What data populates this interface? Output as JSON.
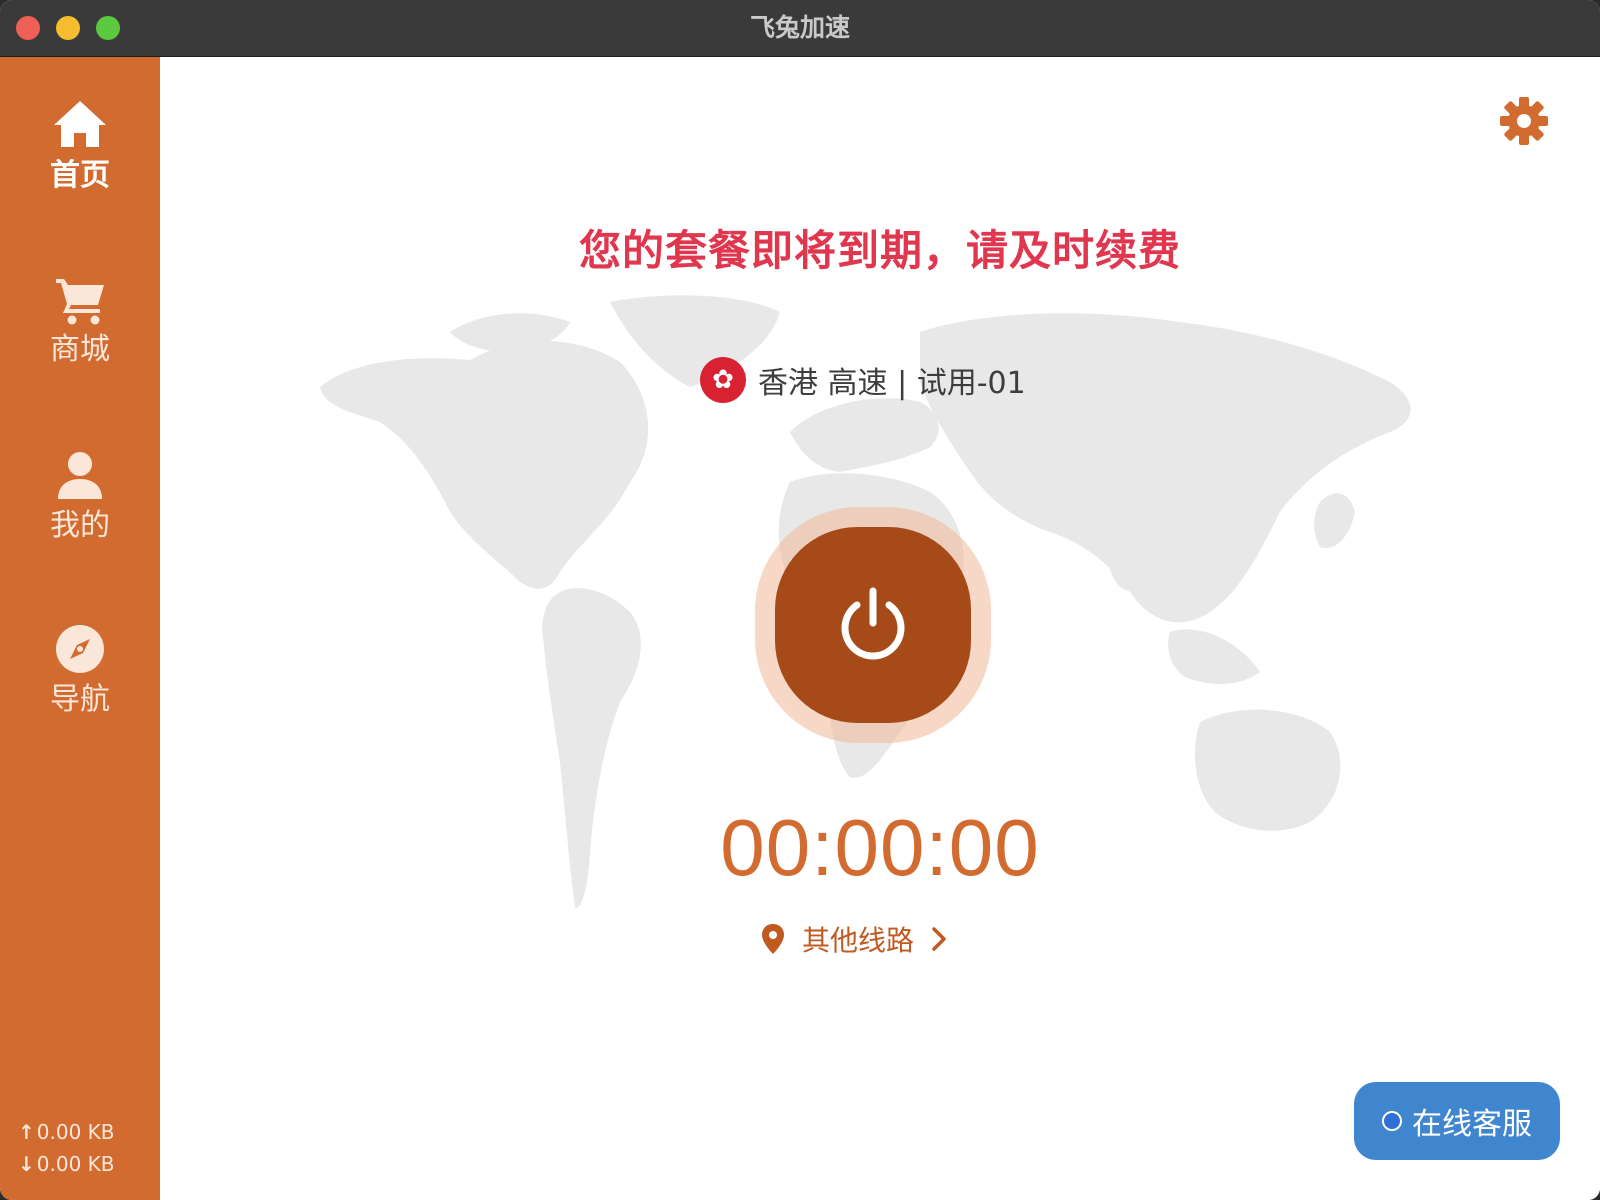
{
  "window": {
    "title": "飞兔加速"
  },
  "sidebar": {
    "items": [
      {
        "label": "首页",
        "icon": "home-icon",
        "active": true
      },
      {
        "label": "商城",
        "icon": "cart-icon",
        "active": false
      },
      {
        "label": "我的",
        "icon": "user-icon",
        "active": false
      },
      {
        "label": "导航",
        "icon": "compass-icon",
        "active": false
      }
    ],
    "upload": "0.00 KB",
    "download": "0.00 KB"
  },
  "main": {
    "warning": "您的套餐即将到期，请及时续费",
    "server": {
      "flag_icon": "hong-kong-flag-icon",
      "name": "香港 高速 | 试用-01"
    },
    "timer": "00:00:00",
    "other_lines_label": "其他线路",
    "support_label": "在线客服"
  },
  "colors": {
    "sidebar": "#d26b2f",
    "power_button": "#a64a19",
    "warning_text": "#e0374f",
    "timer": "#d26b2f",
    "support_button": "#3f86cf"
  }
}
